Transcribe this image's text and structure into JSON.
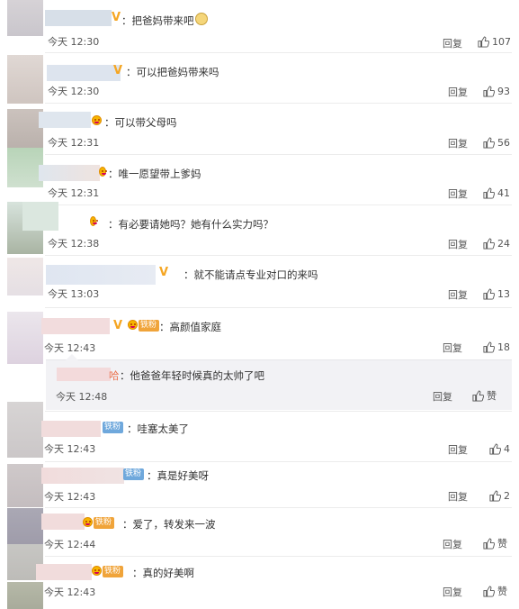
{
  "labels": {
    "reply": "回复"
  },
  "comments": [
    {
      "text": "把爸妈带来吧",
      "time": "今天 12:30",
      "likes": "107"
    },
    {
      "text": "可以把爸妈带来吗",
      "time": "今天 12:30",
      "likes": "93"
    },
    {
      "text": "可以带父母吗",
      "time": "今天 12:31",
      "likes": "56"
    },
    {
      "text": "唯一愿望带上爹妈",
      "time": "今天 12:31",
      "likes": "41"
    },
    {
      "text": "有必要请她吗？她有什么实力吗？",
      "time": "今天 12:38",
      "likes": "24"
    },
    {
      "text": "就不能请点专业对口的来吗",
      "time": "今天 13:03",
      "likes": "13"
    },
    {
      "text": "高颜值家庭",
      "time": "今天 12:43",
      "likes": "18",
      "badge": "铁粉"
    },
    {
      "text": "哇塞太美了",
      "time": "今天 12:43",
      "likes": "4",
      "badge": "铁粉"
    },
    {
      "text": "真是好美呀",
      "time": "今天 12:43",
      "likes": "2",
      "badge": "铁粉"
    },
    {
      "text": "爱了，转发来一波",
      "time": "今天 12:44",
      "likes": "赞",
      "badge": "铁粉"
    },
    {
      "text": "真的好美啊",
      "time": "今天 12:43",
      "likes": "赞",
      "badge": "铁粉"
    }
  ],
  "subreply": {
    "name_suffix": "哈",
    "text": "：他爸爸年轻时候真的太帅了吧",
    "time": "今天 12:48",
    "likes": "赞"
  },
  "icons": {
    "like": "thumbs-up-icon",
    "verified": "v-badge-icon",
    "emoji": "emoji-icon",
    "cat_emoji": "cat-face-icon"
  }
}
